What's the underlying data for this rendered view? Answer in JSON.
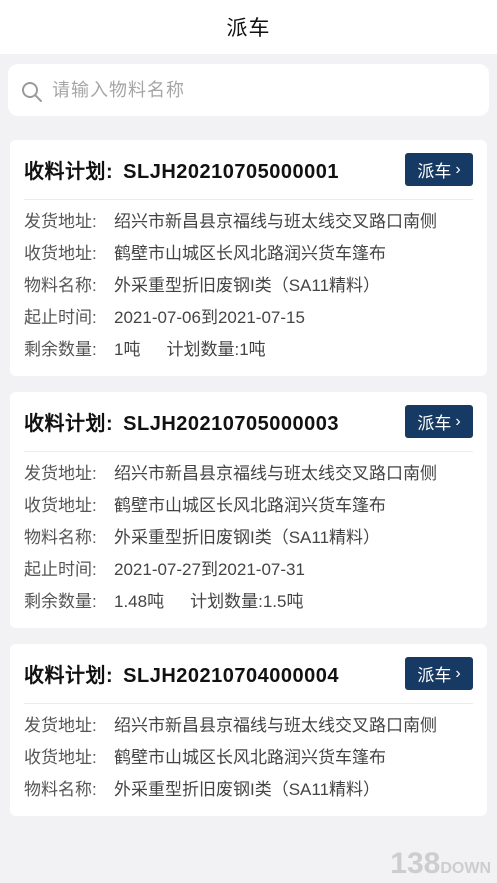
{
  "header": {
    "title": "派车"
  },
  "search": {
    "placeholder": "请输入物料名称",
    "icon": "search-icon"
  },
  "labels": {
    "plan": "收料计划:",
    "dispatch": "派车",
    "ship_addr": "发货地址:",
    "recv_addr": "收货地址:",
    "material": "物料名称:",
    "period": "起止时间:",
    "remain": "剩余数量:",
    "planned": "计划数量:"
  },
  "cards": [
    {
      "plan_no": "SLJH20210705000001",
      "ship_addr": "绍兴市新昌县京福线与班太线交叉路口南侧",
      "recv_addr": "鹤壁市山城区长风北路润兴货车篷布",
      "material": "外采重型折旧废钢I类（SA11精料）",
      "period": "2021-07-06到2021-07-15",
      "remain": "1吨",
      "planned": "1吨"
    },
    {
      "plan_no": "SLJH20210705000003",
      "ship_addr": "绍兴市新昌县京福线与班太线交叉路口南侧",
      "recv_addr": "鹤壁市山城区长风北路润兴货车篷布",
      "material": "外采重型折旧废钢I类（SA11精料）",
      "period": "2021-07-27到2021-07-31",
      "remain": "1.48吨",
      "planned": "1.5吨"
    },
    {
      "plan_no": "SLJH20210704000004",
      "ship_addr": "绍兴市新昌县京福线与班太线交叉路口南侧",
      "recv_addr": "鹤壁市山城区长风北路润兴货车篷布",
      "material": "外采重型折旧废钢I类（SA11精料）"
    }
  ],
  "watermark": {
    "main": "138",
    "sub": "DOWN"
  },
  "colors": {
    "accent": "#173a64",
    "background": "#f2f2f4"
  }
}
